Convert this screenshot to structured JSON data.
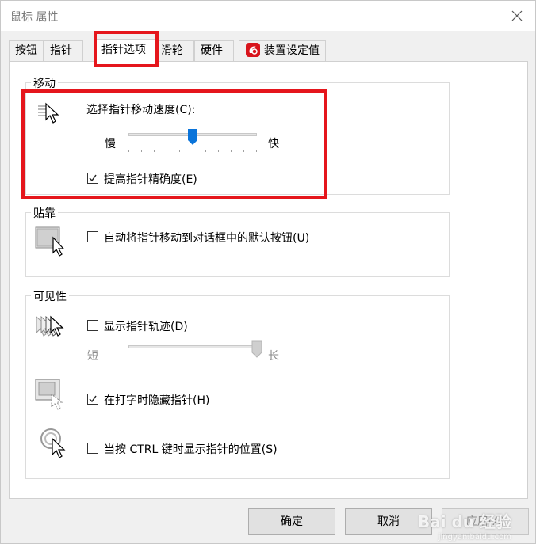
{
  "window": {
    "title": "鼠标 属性"
  },
  "tabs": [
    {
      "label": "按钮"
    },
    {
      "label": "指针"
    },
    {
      "label": "指针选项"
    },
    {
      "label": "滑轮"
    },
    {
      "label": "硬件"
    },
    {
      "label": "装置设定值"
    }
  ],
  "motion": {
    "group_label": "移动",
    "speed_label": "选择指针移动速度(C):",
    "slow_label": "慢",
    "fast_label": "快",
    "speed_fraction": 0.5,
    "precision_label": "提高指针精确度(E)",
    "precision_checked": true
  },
  "snap": {
    "group_label": "贴靠",
    "snap_label": "自动将指针移动到对话框中的默认按钮(U)",
    "snap_checked": false
  },
  "visibility": {
    "group_label": "可见性",
    "trails_label": "显示指针轨迹(D)",
    "trails_checked": false,
    "short_label": "短",
    "long_label": "长",
    "trail_fraction": 1.0,
    "hide_label": "在打字时隐藏指针(H)",
    "hide_checked": true,
    "ctrl_label": "当按 CTRL 键时显示指针的位置(S)",
    "ctrl_checked": false
  },
  "buttons": {
    "ok": "确定",
    "cancel": "取消",
    "apply": "应用(A)"
  },
  "watermark": {
    "brand": "Bai du 经验",
    "url": "jingyan.baidu.com"
  },
  "colors": {
    "highlight": "#e5161c",
    "thumb": "#0a74da"
  }
}
